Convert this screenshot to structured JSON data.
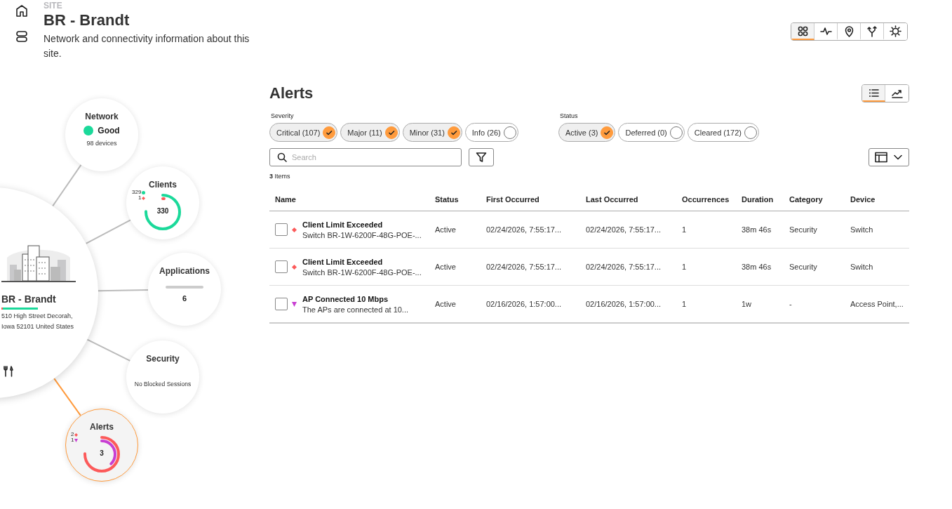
{
  "site": {
    "label": "SITE",
    "title": "BR - Brandt",
    "description": "Network and connectivity information about this site."
  },
  "rail": [
    {
      "kind": "home"
    },
    {
      "kind": "servers"
    }
  ],
  "view_tabs": [
    {
      "kind": "grid",
      "selected": true
    },
    {
      "kind": "pulse",
      "selected": false
    },
    {
      "kind": "pin",
      "selected": false
    },
    {
      "kind": "branch",
      "selected": false
    },
    {
      "kind": "settings",
      "selected": false
    }
  ],
  "topology": {
    "center": {
      "name": "BR - Brandt",
      "health": {
        "level": 0.96
      },
      "address": [
        "510 High Street Decorah,",
        "Iowa 52101 United States"
      ]
    },
    "nodes": [
      {
        "kind": "status",
        "title": "Network",
        "selected": false,
        "status": "Good",
        "color": "#1bd99a",
        "detail": "98 devices"
      },
      {
        "kind": "donut",
        "title": "Clients",
        "selected": false,
        "total": "330",
        "legend": [
          {
            "value": "329",
            "kind": "dot",
            "color": "#1bd99a"
          },
          {
            "value": "1",
            "kind": "diamond",
            "color": "#fc5a5a"
          }
        ]
      },
      {
        "kind": "bar",
        "title": "Applications",
        "selected": false,
        "value": "6"
      },
      {
        "kind": "text",
        "title": "Security",
        "selected": false,
        "detail": "No Blocked Sessions"
      },
      {
        "kind": "donut",
        "title": "Alerts",
        "selected": true,
        "total": "3",
        "legend": [
          {
            "value": "2",
            "kind": "diamond",
            "color": "#fc5a5a"
          },
          {
            "value": "1",
            "kind": "triangle",
            "color": "#c83fd2"
          }
        ]
      }
    ]
  },
  "alerts": {
    "title": "Alerts",
    "view_toggle": [
      {
        "kind": "list",
        "selected": true
      },
      {
        "kind": "chart",
        "selected": false
      }
    ],
    "filter_groups": [
      {
        "label": "Severity",
        "chips": [
          {
            "label": "Critical (107)",
            "checked": true
          },
          {
            "label": "Major (11)",
            "checked": true
          },
          {
            "label": "Minor (31)",
            "checked": true
          },
          {
            "label": "Info (26)",
            "checked": false
          }
        ]
      },
      {
        "label": "Status",
        "chips": [
          {
            "label": "Active (3)",
            "checked": true
          },
          {
            "label": "Deferred (0)",
            "checked": false
          },
          {
            "label": "Cleared (172)",
            "checked": false
          }
        ]
      }
    ],
    "search": {
      "placeholder": "Search"
    },
    "item_count": "**3** Items",
    "table": {
      "columns": [
        "Name",
        "Status",
        "First Occurred",
        "Last Occurred",
        "Occurrences",
        "Duration",
        "Category",
        "Device"
      ],
      "rows": [
        {
          "checked": false,
          "kind": "diamond",
          "color": "#fc5a5a",
          "name": {
            "title": "Client Limit Exceeded",
            "detail": "Switch BR-1W-6200F-48G-POE-..."
          },
          "status": "Active",
          "first_occurred": "02/24/2026, 7:55:17...",
          "last_occurred": "02/24/2026, 7:55:17...",
          "occurrences": "1",
          "duration": "38m 46s",
          "category": "Security",
          "device": "Switch"
        },
        {
          "checked": false,
          "kind": "diamond",
          "color": "#fc5a5a",
          "name": {
            "title": "Client Limit Exceeded",
            "detail": "Switch BR-1W-6200F-48G-POE-..."
          },
          "status": "Active",
          "first_occurred": "02/24/2026, 7:55:17...",
          "last_occurred": "02/24/2026, 7:55:17...",
          "occurrences": "1",
          "duration": "38m 46s",
          "category": "Security",
          "device": "Switch"
        },
        {
          "checked": false,
          "kind": "triangle",
          "color": "#c83fd2",
          "name": {
            "title": "AP Connected 10 Mbps",
            "detail": "The APs are connected at 10..."
          },
          "status": "Active",
          "first_occurred": "02/16/2026, 1:57:00...",
          "last_occurred": "02/16/2026, 1:57:00...",
          "occurrences": "1",
          "duration": "1w",
          "category": "-",
          "device": "Access Point,..."
        }
      ]
    }
  }
}
